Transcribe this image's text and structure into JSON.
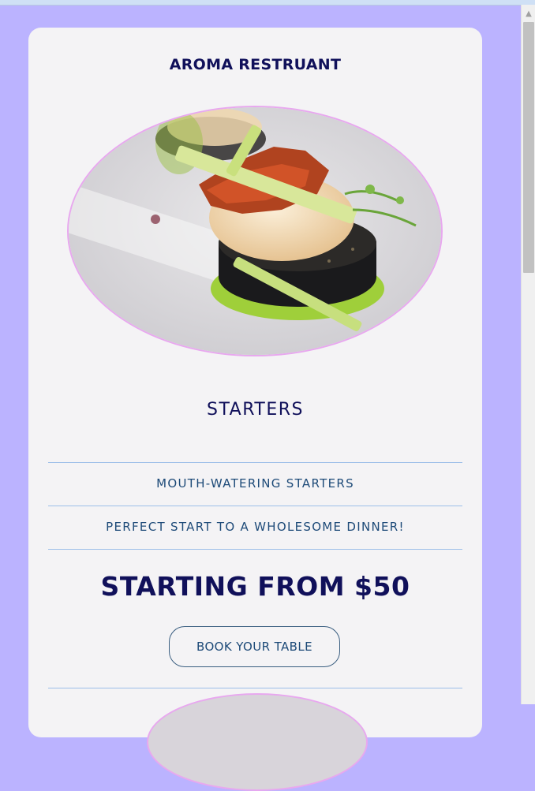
{
  "colors": {
    "page_bg": "#bbb3ff",
    "card_bg": "#f4f3f5",
    "heading": "#10105a",
    "text_blue": "#1d4a78",
    "divider": "#9dbfe8",
    "image_border": "#e8a8ef"
  },
  "brand": {
    "name": "AROMA RESTRUANT"
  },
  "hero_image": {
    "icon": "scallop-dish-photo"
  },
  "section": {
    "title": "STARTERS",
    "subtitle": "MOUTH-WATERING STARTERS",
    "tagline": "PERFECT START TO A WHOLESOME DINNER!",
    "price": "STARTING FROM $50",
    "button_label": "BOOK YOUR TABLE"
  },
  "scrollbar": {
    "up_icon": "arrow-up-icon"
  }
}
